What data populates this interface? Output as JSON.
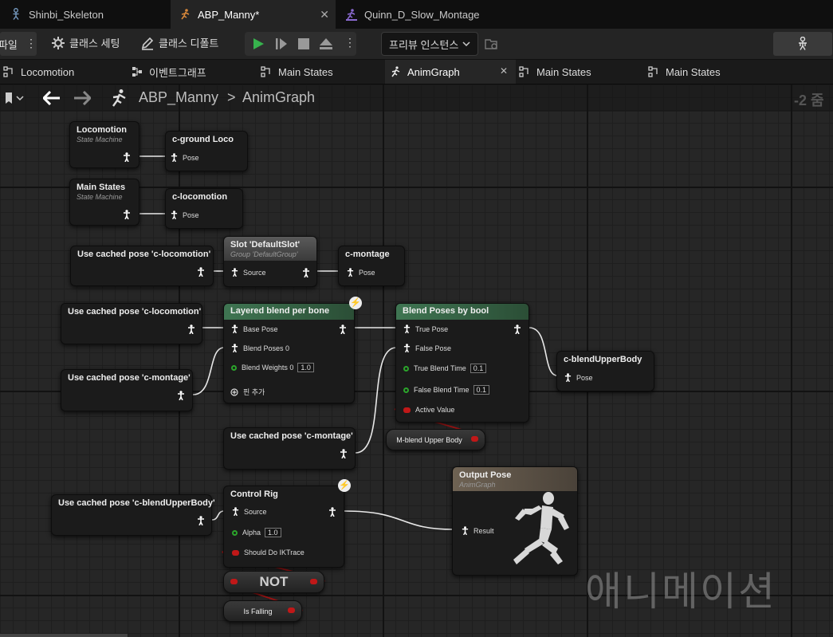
{
  "document_tabs": [
    {
      "label": "Shinbi_Skeleton",
      "icon": "skeleton-icon"
    },
    {
      "label": "ABP_Manny*",
      "icon": "anim-blueprint-icon",
      "active": true
    },
    {
      "label": "Quinn_D_Slow_Montage",
      "icon": "montage-icon"
    }
  ],
  "toolbar": {
    "compile_label": "컴파일",
    "class_settings": "클래스 세팅",
    "class_defaults": "클래스 디폴트",
    "preview_instance": "프리뷰 인스턴스"
  },
  "graph_tabs": [
    {
      "label": "Locomotion",
      "icon": "state-machine-icon"
    },
    {
      "label": "이벤트그래프",
      "icon": "event-graph-icon"
    },
    {
      "label": "Main States",
      "icon": "state-machine-icon"
    },
    {
      "label": "AnimGraph",
      "icon": "running-man-icon",
      "active": true
    },
    {
      "label": "Main States",
      "icon": "state-machine-icon"
    },
    {
      "label": "Main States",
      "icon": "state-machine-icon"
    }
  ],
  "breadcrumb": {
    "root": "ABP_Manny",
    "separator": ">",
    "current": "AnimGraph",
    "zoom": "-2 줌"
  },
  "nodes": {
    "locomotion_sm": {
      "title": "Locomotion",
      "subtitle": "State Machine"
    },
    "cground_loco": {
      "title": "c-ground Loco",
      "pin": "Pose"
    },
    "mainstates_sm": {
      "title": "Main States",
      "subtitle": "State Machine"
    },
    "clocomotion_cache": {
      "title": "c-locomotion",
      "pin": "Pose"
    },
    "use_cached_loco_1": {
      "title": "Use cached pose 'c-locomotion'"
    },
    "slot": {
      "title": "Slot 'DefaultSlot'",
      "subtitle": "Group 'DefaultGroup'",
      "pin": "Source"
    },
    "cmontage_cache": {
      "title": "c-montage",
      "pin": "Pose"
    },
    "use_cached_loco_2": {
      "title": "Use cached pose 'c-locomotion'"
    },
    "layered_blend": {
      "title": "Layered blend per bone",
      "base_pose": "Base Pose",
      "blend_poses": "Blend Poses 0",
      "blend_weights": "Blend Weights 0",
      "blend_weights_value": "1.0",
      "add_pin": "핀 추가"
    },
    "blend_bool": {
      "title": "Blend Poses by bool",
      "true_pose": "True Pose",
      "false_pose": "False Pose",
      "true_blend": "True Blend Time",
      "true_blend_value": "0.1",
      "false_blend": "False Blend Time",
      "false_blend_value": "0.1",
      "active_value": "Active Value"
    },
    "cblend_cache": {
      "title": "c-blendUpperBody",
      "pin": "Pose"
    },
    "use_cached_montage_1": {
      "title": "Use cached pose 'c-montage'"
    },
    "use_cached_montage_2": {
      "title": "Use cached pose 'c-montage'"
    },
    "mblend_var": {
      "title": "M-blend Upper Body"
    },
    "output_pose": {
      "title": "Output Pose",
      "subtitle": "AnimGraph",
      "pin": "Result"
    },
    "use_cached_blend": {
      "title": "Use cached pose 'c-blendUpperBody'"
    },
    "control_rig": {
      "title": "Control Rig",
      "source": "Source",
      "alpha": "Alpha",
      "alpha_value": "1.0",
      "ik_trace": "Should Do IKTrace"
    },
    "not_node": {
      "title": "NOT"
    },
    "is_falling": {
      "title": "Is Falling"
    }
  },
  "watermark": "애니메이션",
  "colors": {
    "accent_green": "#37b24d",
    "pose_header_green": "#3c6a46",
    "bool_pin_red": "#c01818"
  }
}
